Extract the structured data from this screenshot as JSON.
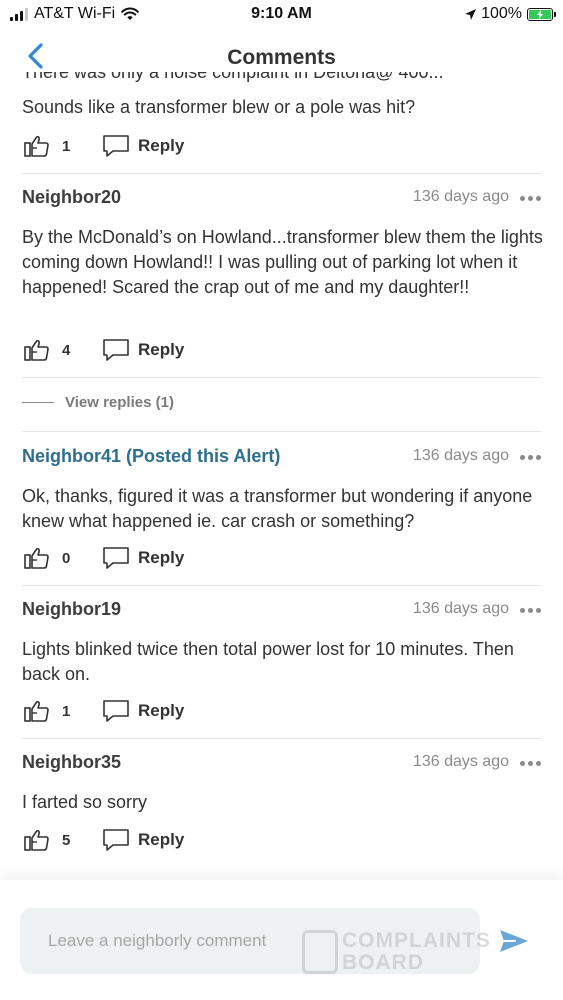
{
  "status_bar": {
    "carrier": "AT&T Wi-Fi",
    "time": "9:10 AM",
    "battery": "100%",
    "icons": [
      "signal-icon",
      "wifi-icon",
      "location-icon",
      "battery-charging-icon"
    ]
  },
  "header": {
    "title": "Comments",
    "back_icon": "chevron-left-icon"
  },
  "top_comment": {
    "clipped_text": "There was only a noise complaint in Deltona@ 400...",
    "body": "Sounds like a transformer blew or a pole was hit?",
    "likes": "1",
    "reply_label": "Reply"
  },
  "comments": [
    {
      "author": "Neighbor20",
      "time": "136 days ago",
      "body": "By the McDonald’s on Howland...transformer blew them the lights coming down Howland!! I was pulling out of parking lot when it happened! Scared the crap out of me and my daughter!!",
      "likes": "4",
      "reply_label": "Reply"
    },
    {
      "author": "Neighbor41 (Posted this Alert)",
      "time": "136 days ago",
      "body": "Ok, thanks, figured it was a transformer but wondering if anyone knew what happened ie. car crash or something?",
      "likes": "0",
      "reply_label": "Reply"
    },
    {
      "author": "Neighbor19",
      "time": "136 days ago",
      "body": "Lights blinked twice then total power lost for 10 minutes. Then back on.",
      "likes": "1",
      "reply_label": "Reply"
    },
    {
      "author": "Neighbor35",
      "time": "136 days ago",
      "body": "I farted so sorry",
      "likes": "5",
      "reply_label": "Reply"
    }
  ],
  "view_replies": "View replies (1)",
  "composer": {
    "placeholder": "Leave a neighborly comment",
    "value": "",
    "send_icon": "send-icon"
  },
  "watermark": {
    "line1": "COMPLAINTS",
    "line2": "BOARD"
  },
  "colors": {
    "accent": "#2e8ad8",
    "op_author": "#2c6f8e",
    "timestamp": "#8a8a8a",
    "input_bg": "#eef1f1",
    "send": "#6aa6d8"
  }
}
